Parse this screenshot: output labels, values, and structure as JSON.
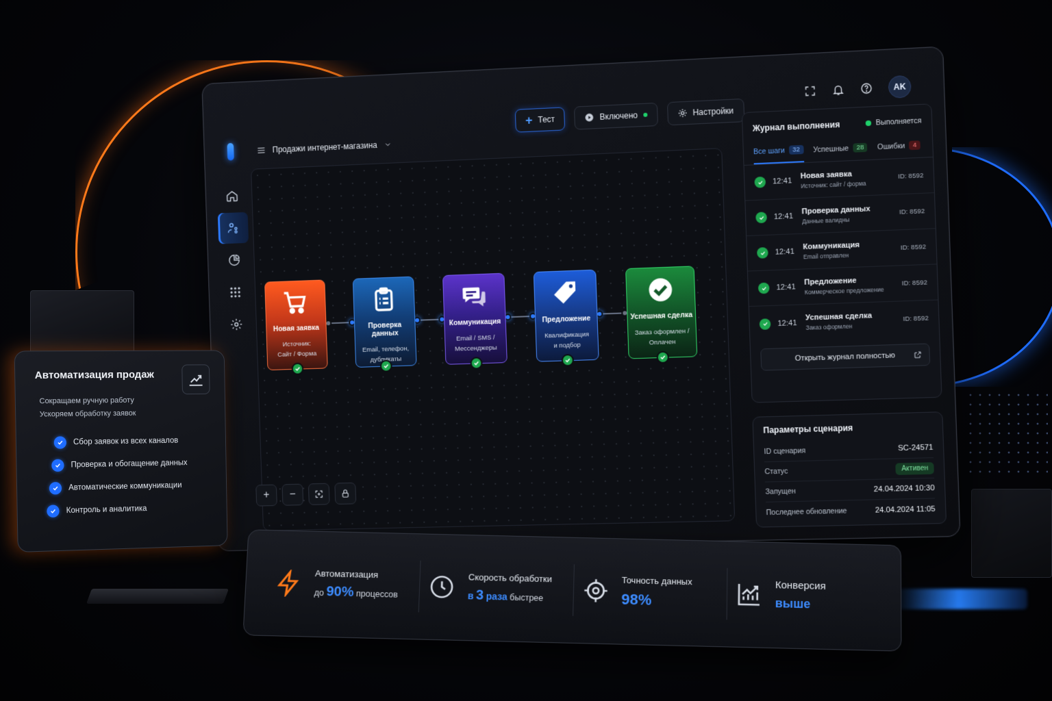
{
  "header": {
    "workflow_name": "Продажи интернет-магазина",
    "test_label": "Тест",
    "enabled_label": "Включено",
    "settings_label": "Настройки",
    "avatar_initials": "AK"
  },
  "nodes": [
    {
      "title": "Новая заявка",
      "sub_1": "Источник:",
      "sub_2": "Сайт / Форма",
      "icon": "cart-icon"
    },
    {
      "title": "Проверка данных",
      "sub_1": "Email, телефон,",
      "sub_2": "дубликаты",
      "icon": "clipboard-icon"
    },
    {
      "title": "Коммуникация",
      "sub_1": "Email / SMS /",
      "sub_2": "Мессенджеры",
      "icon": "chat-icon"
    },
    {
      "title": "Предложение",
      "sub_1": "Квалификация",
      "sub_2": "и подбор",
      "icon": "tag-icon"
    },
    {
      "title": "Успешная сделка",
      "sub_1": "Заказ оформлен /",
      "sub_2": "Оплачен",
      "icon": "check-circle-icon"
    }
  ],
  "journal": {
    "title": "Журнал выполнения",
    "status": "Выполняется",
    "tabs": [
      {
        "label": "Все шаги",
        "count": "32"
      },
      {
        "label": "Успешные",
        "count": "28"
      },
      {
        "label": "Ошибки",
        "count": "4"
      }
    ],
    "rows": [
      {
        "time": "12:41",
        "name": "Новая заявка",
        "desc": "Источник: сайт / форма",
        "id": "ID: 8592"
      },
      {
        "time": "12:41",
        "name": "Проверка данных",
        "desc": "Данные валидны",
        "id": "ID: 8592"
      },
      {
        "time": "12:41",
        "name": "Коммуникация",
        "desc": "Email отправлен",
        "id": "ID: 8592"
      },
      {
        "time": "12:41",
        "name": "Предложение",
        "desc": "Коммерческое предложение",
        "id": "ID: 8592"
      },
      {
        "time": "12:41",
        "name": "Успешная сделка",
        "desc": "Заказ оформлен",
        "id": "ID: 8592"
      }
    ],
    "open_full": "Открыть журнал полностью"
  },
  "params": {
    "title": "Параметры сценария",
    "rows": [
      {
        "label": "ID сценария",
        "value": "SC-24571"
      },
      {
        "label": "Статус",
        "value": "Активен"
      },
      {
        "label": "Запущен",
        "value": "24.04.2024 10:30"
      },
      {
        "label": "Последнее обновление",
        "value": "24.04.2024 11:05"
      }
    ]
  },
  "card": {
    "title": "Автоматизация продаж",
    "sub_1": "Сокращаем ручную работу",
    "sub_2": "Ускоряем обработку заявок",
    "items": [
      "Сбор заявок из всех каналов",
      "Проверка и обогащение данных",
      "Автоматические коммуникации",
      "Контроль и аналитика"
    ]
  },
  "stats": {
    "automation": {
      "label": "Автоматизация",
      "prefix": "до",
      "value": "90%",
      "suffix": "процессов"
    },
    "speed": {
      "label": "Скорость обработки",
      "prefix": "в",
      "value": "3",
      "unit": "раза",
      "suffix": "быстрее"
    },
    "accuracy": {
      "label": "Точность данных",
      "value": "98%"
    },
    "conversion": {
      "label": "Конверсия",
      "value": "выше"
    }
  },
  "colors": {
    "accent_blue": "#2d7bff",
    "accent_orange": "#ff7a1a",
    "success_green": "#1fa84f"
  }
}
